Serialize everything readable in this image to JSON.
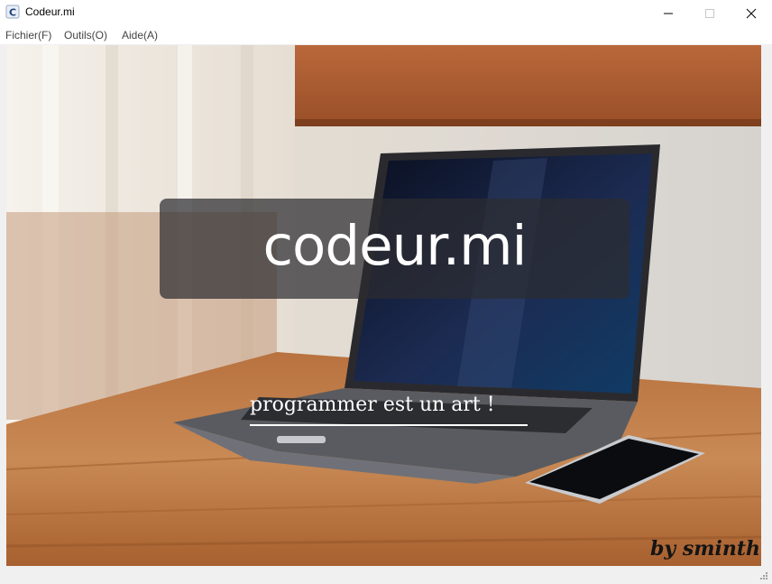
{
  "window": {
    "title": "Codeur.mi",
    "app_icon": "c-letter-icon",
    "controls": [
      "minimize-icon",
      "maximize-icon",
      "close-icon"
    ]
  },
  "menu": {
    "items": [
      {
        "label": "Fichier(F)"
      },
      {
        "label": "Outils(O)"
      },
      {
        "label": "Aide(A)"
      }
    ]
  },
  "content": {
    "heading": "codeur.mi",
    "tagline": "programmer est un art !",
    "byline": "by sminth"
  },
  "colors": {
    "overlay": "#2d2d30",
    "text_light": "#ffffff",
    "byline": "#141414"
  }
}
